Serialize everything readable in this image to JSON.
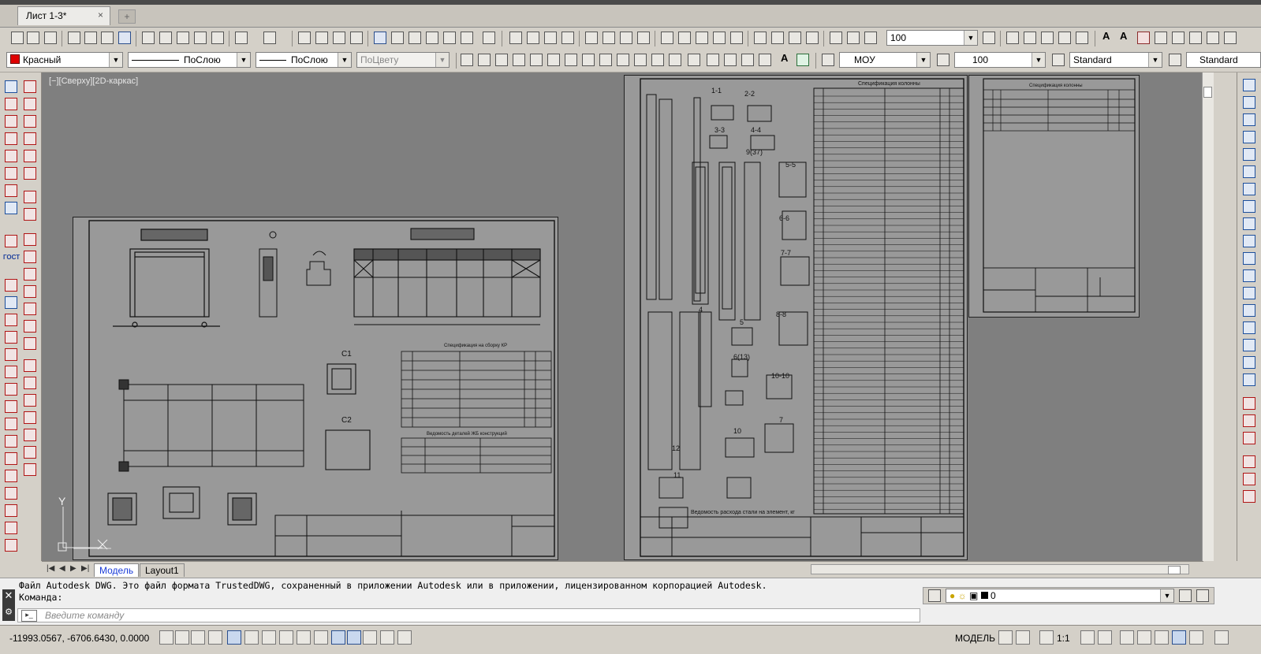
{
  "tabs": {
    "document_tab": "Лист 1-3*",
    "close_symbol": "×",
    "new_tab_symbol": "+"
  },
  "toolbar1": {
    "zoom_value": "100"
  },
  "toolbar2": {
    "color": "Красный",
    "color_hex": "#e00000",
    "linetype": "ПоСлою",
    "lineweight": "ПоСлою",
    "plotstyle": "ПоЦвету",
    "text_style": "МОУ",
    "text_height": "100",
    "dim_style": "Standard",
    "table_style": "Standard"
  },
  "left_tools": {
    "gost_label": "ГОСТ"
  },
  "viewport": {
    "title": "[−][Сверху][2D-каркас]",
    "ucs_y": "Y"
  },
  "sheet1": {
    "title_center": "Спецификация на сборку КР",
    "table_title": "Ведомость деталей ЖБ конструкций",
    "label_c1": "С1",
    "label_c2": "С2"
  },
  "sheet2": {
    "spec_title": "Спецификация колонны",
    "section_labels": [
      "1-1",
      "2-2",
      "3-3",
      "4-4",
      "5-5",
      "6-6",
      "7-7",
      "8-8",
      "9(37)",
      "10-10",
      "6(13)",
      "10",
      "11",
      "12",
      "4",
      "5",
      "7"
    ],
    "bottom_caption": "Ведомость расхода стали на элемент, кг"
  },
  "sheet3": {
    "spec_title": "Спецификация колонны"
  },
  "layout_tabs": {
    "nav": [
      "|◀",
      "◀",
      "▶",
      "▶|"
    ],
    "tabs": [
      "Модель",
      "Layout1"
    ]
  },
  "command": {
    "history": [
      "Файл Autodesk DWG. Это файл формата TrustedDWG, сохраненный в приложении Autodesk или в приложении, лицензированном корпорацией Autodesk.",
      "Команда:"
    ],
    "placeholder": "Введите команду",
    "close_symbol": "✕",
    "layer_value": "0"
  },
  "status": {
    "coordinates": "-11993.0567, -6706.6430, 0.0000",
    "mode": "МОДЕЛЬ",
    "scale": "1:1"
  }
}
